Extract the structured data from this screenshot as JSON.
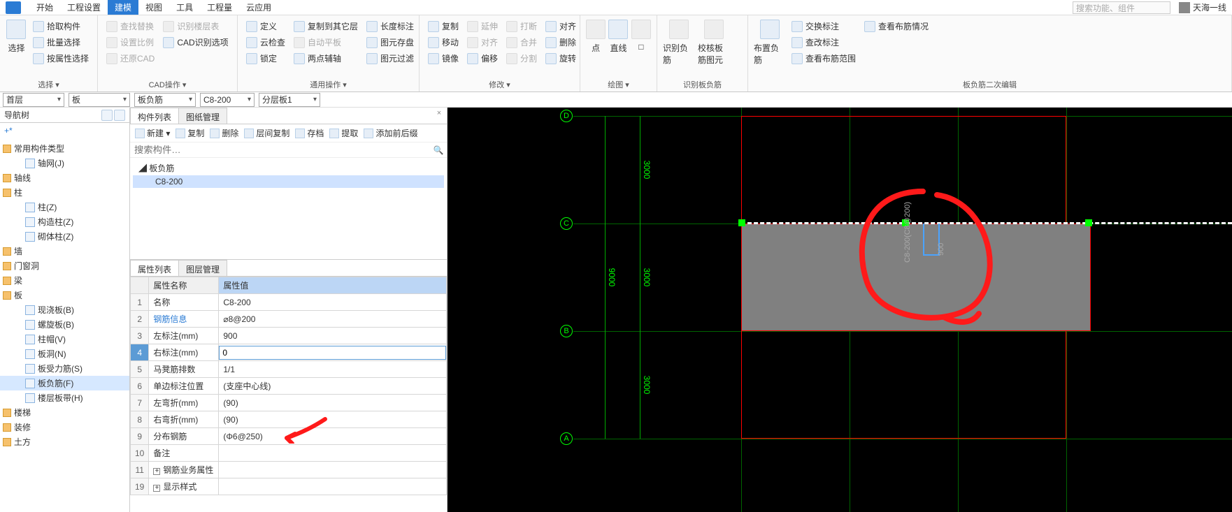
{
  "menu": {
    "items": [
      "开始",
      "工程设置",
      "建模",
      "视图",
      "工具",
      "工程量",
      "云应用"
    ],
    "active_index": 2,
    "search_placeholder": "搜索功能、组件",
    "user_name": "天海一线"
  },
  "ribbon": {
    "select": {
      "big": "选择",
      "items": [
        "拾取构件",
        "批量选择",
        "按属性选择"
      ],
      "footer": "选择 ▾"
    },
    "cad": {
      "items_col1": [
        "查找替换",
        "设置比例",
        "还原CAD"
      ],
      "items_col2": [
        "识别楼层表",
        "CAD识别选项",
        ""
      ],
      "footer": "CAD操作 ▾"
    },
    "general": {
      "col1": [
        "定义",
        "云检查",
        "锁定"
      ],
      "col2": [
        "复制到其它层",
        "自动平板",
        "两点辅轴"
      ],
      "col3": [
        "长度标注",
        "图元存盘",
        "图元过滤"
      ],
      "footer": "通用操作 ▾"
    },
    "modify": {
      "col1": [
        "复制",
        "移动",
        "镜像"
      ],
      "col2": [
        "延伸",
        "对齐",
        "偏移"
      ],
      "col3": [
        "打断",
        "合并",
        "分割"
      ],
      "col4": [
        "对齐",
        "删除",
        "旋转"
      ],
      "footer": "修改 ▾"
    },
    "draw": {
      "items": [
        "点",
        "直线",
        "□"
      ],
      "footer": "绘图 ▾"
    },
    "identify": {
      "items": [
        "识别负筋",
        "校核板筋图元"
      ],
      "btn": "识别板负筋",
      "footer": "识别板负筋"
    },
    "layout": {
      "big": "布置负筋",
      "items": [
        "交换标注",
        "查改标注",
        "查看布筋范围"
      ],
      "extra": "查看布筋情况",
      "footer": "板负筋二次编辑"
    }
  },
  "context": {
    "floor": "首层",
    "category": "板",
    "component_type": "板负筋",
    "component": "C8-200",
    "layer": "分层板1"
  },
  "sidebar": {
    "title": "导航树",
    "nodes": [
      {
        "label": "常用构件类型",
        "depth": 0,
        "fold": true
      },
      {
        "label": "轴网(J)",
        "depth": 2,
        "ic": true
      },
      {
        "label": "轴线",
        "depth": 0,
        "fold": true
      },
      {
        "label": "柱",
        "depth": 0,
        "fold": true
      },
      {
        "label": "柱(Z)",
        "depth": 2,
        "ic": true
      },
      {
        "label": "构造柱(Z)",
        "depth": 2,
        "ic": true
      },
      {
        "label": "砌体柱(Z)",
        "depth": 2,
        "ic": true
      },
      {
        "label": "墙",
        "depth": 0,
        "fold": true
      },
      {
        "label": "门窗洞",
        "depth": 0,
        "fold": true
      },
      {
        "label": "梁",
        "depth": 0,
        "fold": true
      },
      {
        "label": "板",
        "depth": 0,
        "fold": true
      },
      {
        "label": "现浇板(B)",
        "depth": 2,
        "ic": true
      },
      {
        "label": "螺旋板(B)",
        "depth": 2,
        "ic": true
      },
      {
        "label": "柱帽(V)",
        "depth": 2,
        "ic": true
      },
      {
        "label": "板洞(N)",
        "depth": 2,
        "ic": true
      },
      {
        "label": "板受力筋(S)",
        "depth": 2,
        "ic": true
      },
      {
        "label": "板负筋(F)",
        "depth": 2,
        "ic": true,
        "sel": true
      },
      {
        "label": "楼层板带(H)",
        "depth": 2,
        "ic": true
      },
      {
        "label": "楼梯",
        "depth": 0,
        "fold": true
      },
      {
        "label": "装修",
        "depth": 0,
        "fold": true
      },
      {
        "label": "土方",
        "depth": 0,
        "fold": true
      }
    ]
  },
  "center": {
    "tabs": [
      "构件列表",
      "图纸管理"
    ],
    "toolbar": [
      "新建 ▾",
      "复制",
      "删除",
      "层间复制",
      "存档",
      "提取",
      "添加前后缀"
    ],
    "search_placeholder": "搜索构件…",
    "tree_parent": "板负筋",
    "tree_child": "C8-200",
    "prop_tabs": [
      "属性列表",
      "图层管理"
    ],
    "prop_header_name": "属性名称",
    "prop_header_value": "属性值",
    "rows": [
      {
        "n": "1",
        "name": "名称",
        "val": "C8-200",
        "link": false
      },
      {
        "n": "2",
        "name": "钢筋信息",
        "val": "⌀8@200",
        "link": true
      },
      {
        "n": "3",
        "name": "左标注(mm)",
        "val": "900"
      },
      {
        "n": "4",
        "name": "右标注(mm)",
        "val": "0",
        "sel": true
      },
      {
        "n": "5",
        "name": "马凳筋排数",
        "val": "1/1"
      },
      {
        "n": "6",
        "name": "单边标注位置",
        "val": "(支座中心线)"
      },
      {
        "n": "7",
        "name": "左弯折(mm)",
        "val": "(90)"
      },
      {
        "n": "8",
        "name": "右弯折(mm)",
        "val": "(90)"
      },
      {
        "n": "9",
        "name": "分布钢筋",
        "val": "(Φ6@250)"
      },
      {
        "n": "10",
        "name": "备注",
        "val": ""
      },
      {
        "n": "11",
        "name": "钢筋业务属性",
        "val": "",
        "exp": true
      },
      {
        "n": "19",
        "name": "显示样式",
        "val": "",
        "exp": true
      }
    ]
  },
  "canvas": {
    "axis_labels": [
      "A",
      "B",
      "C",
      "D"
    ],
    "h_dims": [
      "3000",
      "3000",
      "3000"
    ],
    "v_dim_total": "9000",
    "rebar_label": "C8-200(C8@200)",
    "rebar_dim": "900"
  }
}
